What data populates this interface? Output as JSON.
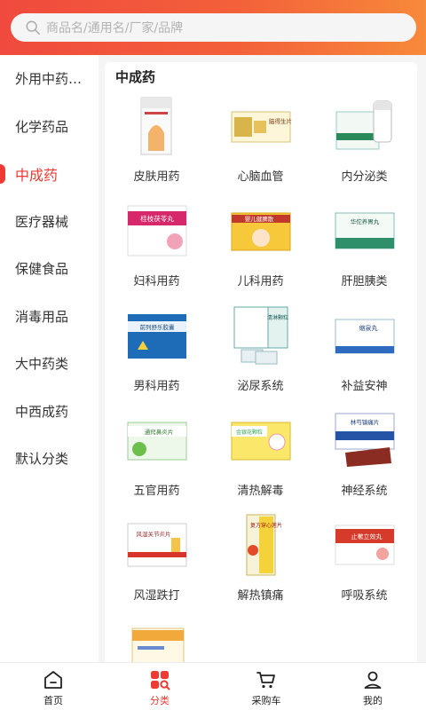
{
  "search": {
    "placeholder": "商品名/通用名/厂家/品牌"
  },
  "sidebar": {
    "items": [
      {
        "label": "外用中药粉剂"
      },
      {
        "label": "化学药品"
      },
      {
        "label": "中成药",
        "active": true
      },
      {
        "label": "医疗器械"
      },
      {
        "label": "保健食品"
      },
      {
        "label": "消毒用品"
      },
      {
        "label": "大中药类"
      },
      {
        "label": "中西成药"
      },
      {
        "label": "默认分类"
      }
    ]
  },
  "panel": {
    "title": "中成药",
    "items": [
      {
        "label": "皮肤用药",
        "thumb_text": ""
      },
      {
        "label": "心脑血管",
        "thumb_text": "脑得生片"
      },
      {
        "label": "内分泌类",
        "thumb_text": ""
      },
      {
        "label": "妇科用药",
        "thumb_text": "桂枝茯苓丸"
      },
      {
        "label": "儿科用药",
        "thumb_text": "婴儿健脾散"
      },
      {
        "label": "肝胆胰类",
        "thumb_text": "华佗养胃丸"
      },
      {
        "label": "男科用药",
        "thumb_text": "前列舒乐胶囊"
      },
      {
        "label": "泌尿系统",
        "thumb_text": "清淋颗粒"
      },
      {
        "label": "补益安神",
        "thumb_text": "缩泉丸"
      },
      {
        "label": "五官用药",
        "thumb_text": "通窍鼻炎片"
      },
      {
        "label": "清热解毒",
        "thumb_text": "金银花颗粒"
      },
      {
        "label": "神经系统",
        "thumb_text": "林芍镇痛片"
      },
      {
        "label": "风湿跌打",
        "thumb_text": "风湿关节炎片"
      },
      {
        "label": "解热镇痛",
        "thumb_text": "复方穿心莲片"
      },
      {
        "label": "呼吸系统",
        "thumb_text": "止嗽立效丸"
      },
      {
        "label": "",
        "thumb_text": ""
      }
    ]
  },
  "tabbar": {
    "items": [
      {
        "label": "首页",
        "icon": "home-icon"
      },
      {
        "label": "分类",
        "icon": "category-icon",
        "active": true
      },
      {
        "label": "采购车",
        "icon": "cart-icon"
      },
      {
        "label": "我的",
        "icon": "profile-icon"
      }
    ]
  },
  "colors": {
    "accent": "#ee3a33",
    "header_start": "#f04a3e",
    "header_end": "#f7893a"
  }
}
